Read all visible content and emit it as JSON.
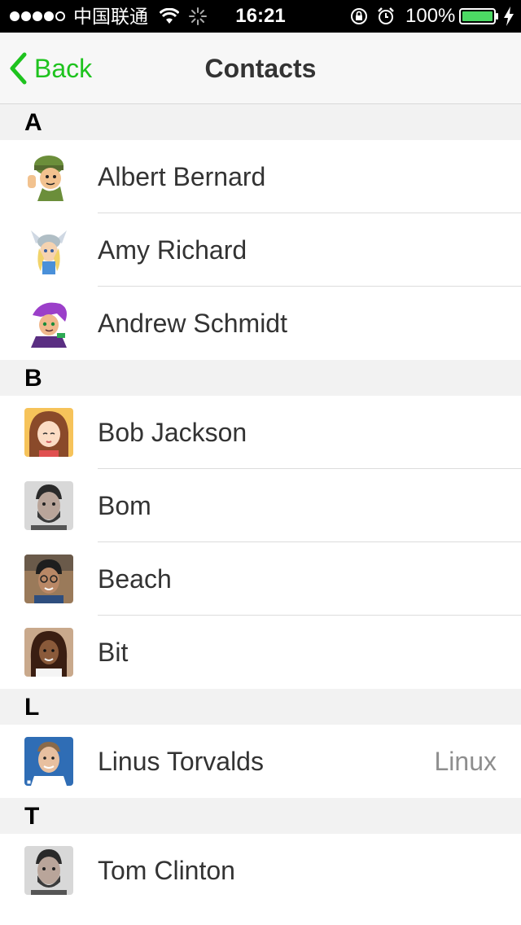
{
  "status_bar": {
    "carrier": "中国联通",
    "time": "16:21",
    "battery": "100%",
    "icons": [
      "signal-dots",
      "wifi-icon",
      "activity-spinner-icon",
      "rotation-lock-icon",
      "alarm-icon",
      "battery-icon",
      "charging-bolt-icon"
    ]
  },
  "nav": {
    "back_label": "Back",
    "title": "Contacts"
  },
  "colors": {
    "accent": "#1ec31e",
    "section_bg": "#f2f2f2",
    "nav_bg": "#f7f7f7",
    "text": "#333333",
    "detail_text": "#8e8e8e"
  },
  "sections": [
    {
      "letter": "A",
      "contacts": [
        {
          "name": "Albert Bernard",
          "detail": "",
          "avatar": "cartoon-soldier"
        },
        {
          "name": "Amy Richard",
          "detail": "",
          "avatar": "cartoon-valkyrie"
        },
        {
          "name": "Andrew Schmidt",
          "detail": "",
          "avatar": "cartoon-purple-hair"
        }
      ]
    },
    {
      "letter": "B",
      "contacts": [
        {
          "name": "Bob Jackson",
          "detail": "",
          "avatar": "cartoon-girl"
        },
        {
          "name": "Bom",
          "detail": "",
          "avatar": "photo-man-bw"
        },
        {
          "name": "Beach",
          "detail": "",
          "avatar": "photo-man-glasses"
        },
        {
          "name": "Bit",
          "detail": "",
          "avatar": "photo-woman"
        }
      ]
    },
    {
      "letter": "L",
      "contacts": [
        {
          "name": "Linus Torvalds",
          "detail": "Linux",
          "avatar": "photo-man-blue"
        }
      ]
    },
    {
      "letter": "T",
      "contacts": [
        {
          "name": "Tom Clinton",
          "detail": "",
          "avatar": "photo-man-bw"
        }
      ]
    }
  ]
}
